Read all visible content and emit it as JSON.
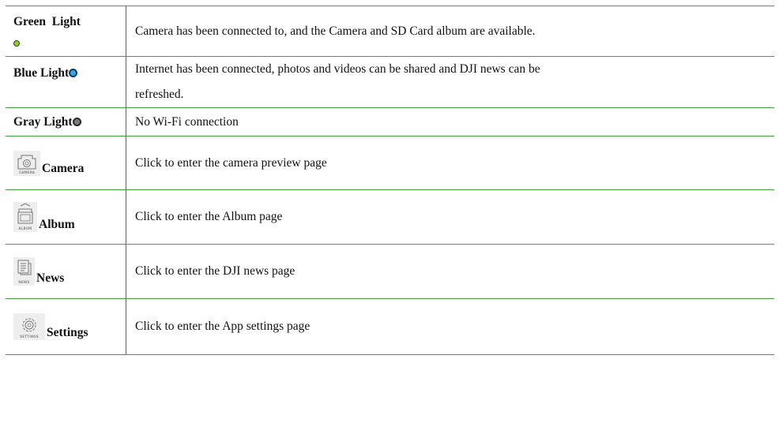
{
  "rows": [
    {
      "term_line1": "Green  Light",
      "light": "green",
      "light_color": "#99c53a",
      "desc": "Camera has been connected to, and the Camera and SD Card album are available."
    },
    {
      "term": "Blue Light",
      "light": "blue",
      "light_color": "#33a6e8",
      "desc_line1": "Internet has been connected, photos and videos can be shared and DJI news can be",
      "desc_line2": "refreshed."
    },
    {
      "term": "Gray Light",
      "light": "gray",
      "light_color": "#7c7c7c",
      "desc": "No Wi-Fi connection"
    },
    {
      "term": "Camera",
      "icon": "camera-icon",
      "icon_caption": "CAMERA",
      "desc": "Click to enter the camera preview page"
    },
    {
      "term": "Album",
      "icon": "album-icon",
      "icon_caption": "ALBUM",
      "desc": "Click to enter the Album page"
    },
    {
      "term": "News",
      "icon": "news-icon",
      "icon_caption": "NEWS",
      "desc": "Click to enter the DJI news page"
    },
    {
      "term": "Settings",
      "icon": "settings-icon",
      "icon_caption": "SETTINGS",
      "desc": "Click to enter the App settings page"
    }
  ],
  "colors": {
    "border_green": "#3ea13b",
    "divider": "#5c6b2e"
  }
}
